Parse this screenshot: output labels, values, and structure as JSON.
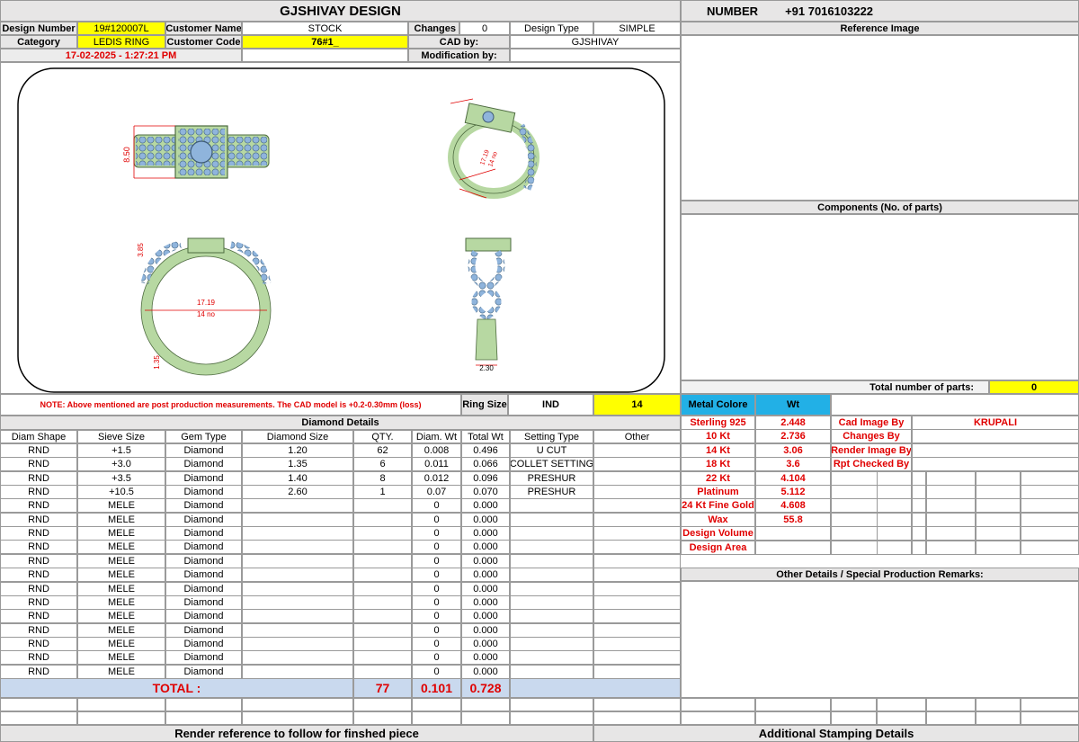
{
  "header": {
    "title": "GJSHIVAY DESIGN",
    "number_label": "NUMBER",
    "number_value": "+91 7016103222"
  },
  "info": {
    "design_number_label": "Design Number",
    "design_number": "19#120007L",
    "customer_name_label": "Customer Name",
    "customer_name": "STOCK",
    "changes_label": "Changes",
    "changes": "0",
    "design_type_label": "Design Type",
    "design_type": "SIMPLE",
    "category_label": "Category",
    "category": "LEDIS RING",
    "customer_code_label": "Customer Code",
    "customer_code": "76#1_",
    "cad_by_label": "CAD by:",
    "cad_by": "GJSHIVAY",
    "date": "17-02-2025 - 1:27:21 PM",
    "modification_label": "Modification by:"
  },
  "drawing": {
    "dim_top": "8.50",
    "dim_side1": "17.19",
    "dim_side2": "14 no",
    "dim_front1": "3.85",
    "dim_front_w": "17.19",
    "dim_front_no": "14 no",
    "dim_front2": "1.35",
    "dim_profile": "2.30"
  },
  "reference_image_label": "Reference Image",
  "components_label": "Components (No. of parts)",
  "total_parts_label": "Total number of parts:",
  "total_parts": "0",
  "note": "NOTE: Above mentioned are post production measurements. The CAD model is +0.2-0.30mm (loss)",
  "ring_size_label": "Ring Size",
  "ring_size_std": "IND",
  "ring_size": "14",
  "metal": {
    "header_color": "Metal Colore",
    "header_wt": "Wt",
    "rows": [
      {
        "name": "Sterling 925",
        "wt": "2.448",
        "label": "Cad Image By",
        "value": "KRUPALI"
      },
      {
        "name": "10 Kt",
        "wt": "2.736",
        "label": "Changes By",
        "value": ""
      },
      {
        "name": "14 Kt",
        "wt": "3.06",
        "label": "Render Image By",
        "value": ""
      },
      {
        "name": "18 Kt",
        "wt": "3.6",
        "label": "Rpt Checked By",
        "value": ""
      },
      {
        "name": "22 Kt",
        "wt": "4.104",
        "label": "",
        "value": ""
      },
      {
        "name": "Platinum",
        "wt": "5.112",
        "label": "",
        "value": ""
      },
      {
        "name": "24 Kt Fine Gold",
        "wt": "4.608",
        "label": "",
        "value": ""
      },
      {
        "name": "Wax",
        "wt": "55.8",
        "label": "",
        "value": ""
      },
      {
        "name": "Design Volume",
        "wt": "",
        "label": "",
        "value": ""
      },
      {
        "name": "Design Area",
        "wt": "",
        "label": "",
        "value": ""
      }
    ]
  },
  "other_details_label": "Other Details / Special Production Remarks:",
  "diamond": {
    "title": "Diamond Details",
    "headers": [
      "Diam Shape",
      "Sieve Size",
      "Gem Type",
      "Diamond Size",
      "QTY.",
      "Diam. Wt",
      "Total Wt",
      "Setting Type",
      "Other"
    ],
    "rows": [
      [
        "RND",
        "+1.5",
        "Diamond",
        "1.20",
        "62",
        "0.008",
        "0.496",
        "U CUT",
        ""
      ],
      [
        "RND",
        "+3.0",
        "Diamond",
        "1.35",
        "6",
        "0.011",
        "0.066",
        "COLLET SETTING",
        ""
      ],
      [
        "RND",
        "+3.5",
        "Diamond",
        "1.40",
        "8",
        "0.012",
        "0.096",
        "PRESHUR",
        ""
      ],
      [
        "RND",
        "+10.5",
        "Diamond",
        "2.60",
        "1",
        "0.07",
        "0.070",
        "PRESHUR",
        ""
      ],
      [
        "RND",
        "MELE",
        "Diamond",
        "",
        "",
        "0",
        "0.000",
        "",
        ""
      ],
      [
        "RND",
        "MELE",
        "Diamond",
        "",
        "",
        "0",
        "0.000",
        "",
        ""
      ],
      [
        "RND",
        "MELE",
        "Diamond",
        "",
        "",
        "0",
        "0.000",
        "",
        ""
      ],
      [
        "RND",
        "MELE",
        "Diamond",
        "",
        "",
        "0",
        "0.000",
        "",
        ""
      ],
      [
        "RND",
        "MELE",
        "Diamond",
        "",
        "",
        "0",
        "0.000",
        "",
        ""
      ],
      [
        "RND",
        "MELE",
        "Diamond",
        "",
        "",
        "0",
        "0.000",
        "",
        ""
      ],
      [
        "RND",
        "MELE",
        "Diamond",
        "",
        "",
        "0",
        "0.000",
        "",
        ""
      ],
      [
        "RND",
        "MELE",
        "Diamond",
        "",
        "",
        "0",
        "0.000",
        "",
        ""
      ],
      [
        "RND",
        "MELE",
        "Diamond",
        "",
        "",
        "0",
        "0.000",
        "",
        ""
      ],
      [
        "RND",
        "MELE",
        "Diamond",
        "",
        "",
        "0",
        "0.000",
        "",
        ""
      ],
      [
        "RND",
        "MELE",
        "Diamond",
        "",
        "",
        "0",
        "0.000",
        "",
        ""
      ],
      [
        "RND",
        "MELE",
        "Diamond",
        "",
        "",
        "0",
        "0.000",
        "",
        ""
      ],
      [
        "RND",
        "MELE",
        "Diamond",
        "",
        "",
        "0",
        "0.000",
        "",
        ""
      ],
      [
        "RND",
        "MELE",
        "Diamond",
        "",
        "",
        "0",
        "0.000",
        "",
        ""
      ]
    ],
    "total_label": "TOTAL :",
    "total_qty": "77",
    "total_diam_wt": "0.101",
    "total_wt": "0.728"
  },
  "footer": {
    "render_ref": "Render reference to follow for finshed piece",
    "stamping": "Additional Stamping Details"
  }
}
